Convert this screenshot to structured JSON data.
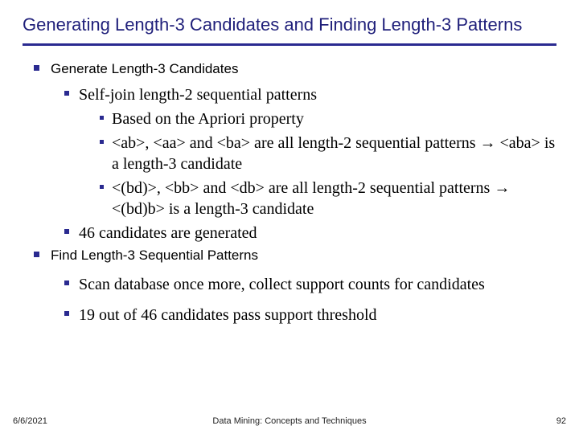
{
  "title": "Generating Length-3 Candidates and Finding Length-3 Patterns",
  "sections": [
    {
      "heading": "Generate Length-3 Candidates",
      "items": [
        {
          "text": "Self-join length-2 sequential patterns",
          "sub": [
            "Based on the Apriori property",
            "<ab>, <aa> and <ba> are all length-2 sequential patterns → <aba> is a length-3 candidate",
            "<(bd)>, <bb> and <db> are all length-2 sequential patterns → <(bd)b> is a length-3 candidate"
          ]
        },
        {
          "text": "46 candidates are generated"
        }
      ]
    },
    {
      "heading": "Find Length-3 Sequential Patterns",
      "items": [
        {
          "text": "Scan database once more, collect support counts for candidates"
        },
        {
          "text": "19 out of 46 candidates pass support threshold"
        }
      ]
    }
  ],
  "footer": {
    "date": "6/6/2021",
    "source": "Data Mining: Concepts and Techniques",
    "page": "92"
  }
}
